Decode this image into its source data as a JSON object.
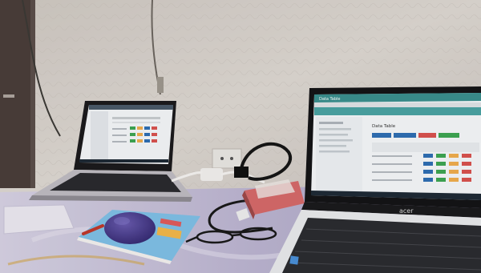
{
  "scene": {
    "right_laptop": {
      "brand_logo": "acer",
      "screen": {
        "title_bar": "Data Table",
        "heading": "Data Table",
        "action_buttons": [
          {
            "color": "#2f6fb3"
          },
          {
            "color": "#2f6fb3"
          },
          {
            "color": "#d9534f"
          },
          {
            "color": "#3ea653"
          }
        ],
        "cell_colors": [
          "#2f6fb3",
          "#3ea653",
          "#f0ad4e",
          "#d9534f"
        ]
      }
    },
    "left_laptop": {
      "screen": {
        "cell_colors": [
          "#3ea653",
          "#f0ad4e",
          "#2f6fb3",
          "#d9534f"
        ]
      }
    },
    "colors": {
      "wall": "#d8d2cb",
      "desk_cloth": "#c9c4d8",
      "mouse": "#4b3a8e",
      "book_cover": "#7fc0e6",
      "router": "#d66a6a"
    }
  }
}
